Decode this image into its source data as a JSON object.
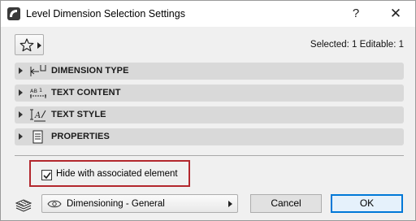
{
  "window": {
    "title": "Level Dimension Selection Settings",
    "help_label": "?",
    "close_label": "✕"
  },
  "header": {
    "selected_info": "Selected: 1 Editable: 1"
  },
  "panels": [
    {
      "label": "DIMENSION TYPE",
      "icon": "dimension-type-icon"
    },
    {
      "label": "TEXT CONTENT",
      "icon": "text-content-icon"
    },
    {
      "label": "TEXT STYLE",
      "icon": "text-style-icon"
    },
    {
      "label": "PROPERTIES",
      "icon": "properties-icon"
    }
  ],
  "options": {
    "hide_with_associated_label": "Hide with associated element",
    "hide_with_associated_checked": true
  },
  "footer": {
    "layer_value": "Dimensioning - General",
    "cancel_label": "Cancel",
    "ok_label": "OK"
  },
  "colors": {
    "highlight": "#b3272d",
    "default_button_border": "#0078d7"
  }
}
